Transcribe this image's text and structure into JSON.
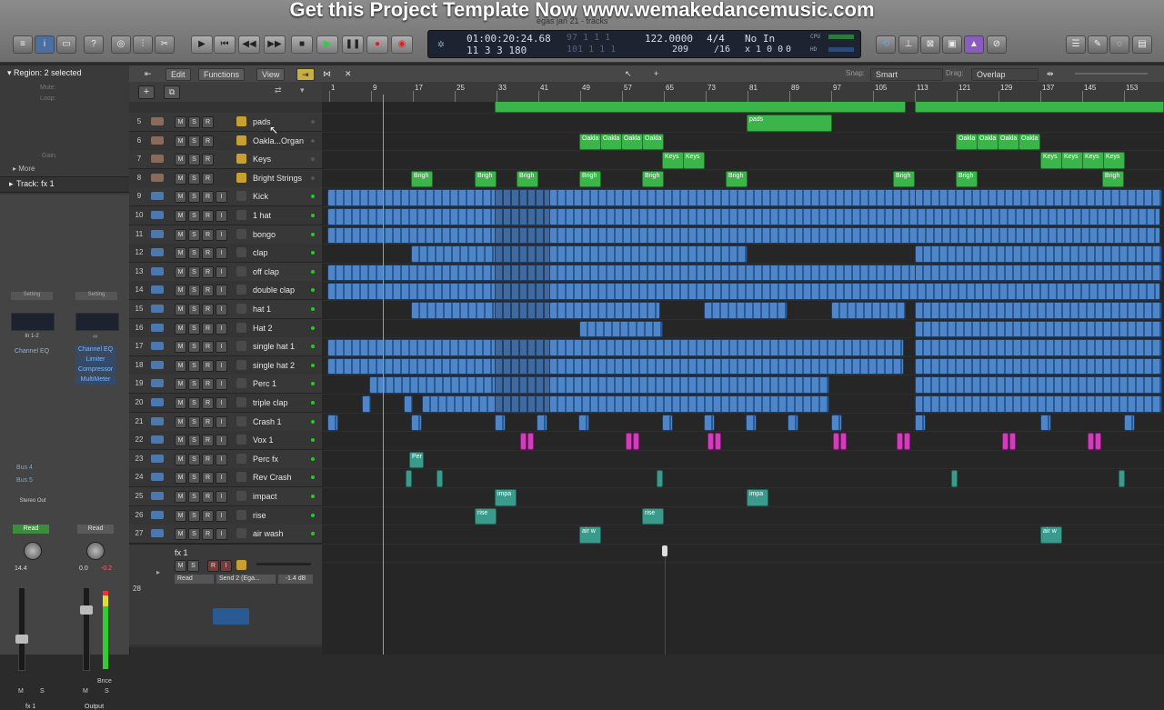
{
  "banner": "Get this Project Template Now www.wemakedancemusic.com",
  "window_title": "egas jan 21 - tracks",
  "lcd": {
    "time": "01:00:20:24.68",
    "bars": "11  3  3  180",
    "time_dim": "97  1  1  1",
    "bars_dim": "101  1  1  1",
    "tempo": "122.0000",
    "tempo_sub": "209",
    "signature": "4/4",
    "division": "/16",
    "input": "No In",
    "output_sub": "x 1  0  0",
    "output_extra": "0",
    "cpu": "CPU",
    "hd": "HD"
  },
  "inspector": {
    "region_header": "Region: 2 selected",
    "mute": "Mute:",
    "loop": "Loop:",
    "gain": "Gain:",
    "more": "More",
    "track_header": "Track:  fx 1",
    "setting1": "Setting",
    "setting2": "Setting",
    "input": "In 1-2",
    "eq1": "Channel EQ",
    "plugins": [
      "Channel EQ",
      "Limiter",
      "Compressor",
      "MultiMeter"
    ],
    "bus1": "Bus 4",
    "bus2": "Bus 5",
    "output": "Stereo Out",
    "read1": "Read",
    "read2": "Read",
    "val1": "14.4",
    "val2a": "0.0",
    "val2b": "-0.2",
    "bnce": "Bnce",
    "strip1": "fx 1",
    "strip2": "Output",
    "ms1": [
      "M",
      "S"
    ],
    "ms2": [
      "M",
      "S"
    ]
  },
  "edit_bar": {
    "edit": "Edit",
    "functions": "Functions",
    "view": "View",
    "snap_label": "Snap:",
    "snap_value": "Smart",
    "drag_label": "Drag:",
    "drag_value": "Overlap"
  },
  "ruler_marks": [
    "1",
    "9",
    "17",
    "25",
    "33",
    "41",
    "49",
    "57",
    "65",
    "73",
    "81",
    "89",
    "97",
    "105",
    "113",
    "121",
    "129",
    "137",
    "145",
    "153"
  ],
  "tracks": [
    {
      "num": "5",
      "name": "pads",
      "type": "inst"
    },
    {
      "num": "6",
      "name": "Oakla...Organ",
      "type": "inst"
    },
    {
      "num": "7",
      "name": "Keys",
      "type": "inst"
    },
    {
      "num": "8",
      "name": "Bright Strings",
      "type": "inst"
    },
    {
      "num": "9",
      "name": "Kick",
      "type": "audio"
    },
    {
      "num": "10",
      "name": "1 hat",
      "type": "audio"
    },
    {
      "num": "11",
      "name": "bongo",
      "type": "audio"
    },
    {
      "num": "12",
      "name": "clap",
      "type": "audio"
    },
    {
      "num": "13",
      "name": "off clap",
      "type": "audio"
    },
    {
      "num": "14",
      "name": "double clap",
      "type": "audio"
    },
    {
      "num": "15",
      "name": "hat 1",
      "type": "audio"
    },
    {
      "num": "16",
      "name": "Hat 2",
      "type": "audio"
    },
    {
      "num": "17",
      "name": "single hat 1",
      "type": "audio"
    },
    {
      "num": "18",
      "name": "single hat 2",
      "type": "audio"
    },
    {
      "num": "19",
      "name": "Perc 1",
      "type": "audio"
    },
    {
      "num": "20",
      "name": "triple clap",
      "type": "audio"
    },
    {
      "num": "21",
      "name": "Crash 1",
      "type": "audio"
    },
    {
      "num": "22",
      "name": "Vox 1",
      "type": "audio"
    },
    {
      "num": "23",
      "name": "Perc fx",
      "type": "audio"
    },
    {
      "num": "24",
      "name": "Rev Crash",
      "type": "audio"
    },
    {
      "num": "25",
      "name": "impact",
      "type": "audio"
    },
    {
      "num": "26",
      "name": "rise",
      "type": "audio"
    },
    {
      "num": "27",
      "name": "air wash",
      "type": "audio"
    }
  ],
  "fx_track": {
    "num": "28",
    "name": "fx 1",
    "read": "Read",
    "send": "Send 2 (Ega...",
    "db": "-1.4 dB"
  },
  "region_labels": {
    "pads": "pads",
    "oakla": "Oakla",
    "keys": "Keys",
    "bright": "Brigh",
    "perc": "Per",
    "impact": "impa",
    "rise": "rise",
    "air": "air w"
  },
  "colors": {
    "region_green": "#3bb54a",
    "region_blue": "#4f86c9",
    "region_teal": "#3a9a8c",
    "region_pink": "#d43bbd",
    "play_green": "#2ecc40",
    "record_red": "#e02020"
  }
}
